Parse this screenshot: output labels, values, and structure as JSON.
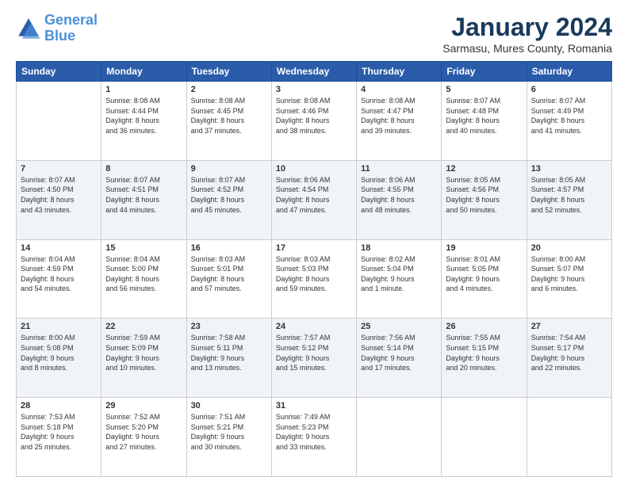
{
  "header": {
    "logo_line1": "General",
    "logo_line2": "Blue",
    "title": "January 2024",
    "subtitle": "Sarmasu, Mures County, Romania"
  },
  "days_of_week": [
    "Sunday",
    "Monday",
    "Tuesday",
    "Wednesday",
    "Thursday",
    "Friday",
    "Saturday"
  ],
  "weeks": [
    [
      {
        "day": "",
        "info": ""
      },
      {
        "day": "1",
        "info": "Sunrise: 8:08 AM\nSunset: 4:44 PM\nDaylight: 8 hours\nand 36 minutes."
      },
      {
        "day": "2",
        "info": "Sunrise: 8:08 AM\nSunset: 4:45 PM\nDaylight: 8 hours\nand 37 minutes."
      },
      {
        "day": "3",
        "info": "Sunrise: 8:08 AM\nSunset: 4:46 PM\nDaylight: 8 hours\nand 38 minutes."
      },
      {
        "day": "4",
        "info": "Sunrise: 8:08 AM\nSunset: 4:47 PM\nDaylight: 8 hours\nand 39 minutes."
      },
      {
        "day": "5",
        "info": "Sunrise: 8:07 AM\nSunset: 4:48 PM\nDaylight: 8 hours\nand 40 minutes."
      },
      {
        "day": "6",
        "info": "Sunrise: 8:07 AM\nSunset: 4:49 PM\nDaylight: 8 hours\nand 41 minutes."
      }
    ],
    [
      {
        "day": "7",
        "info": "Sunrise: 8:07 AM\nSunset: 4:50 PM\nDaylight: 8 hours\nand 43 minutes."
      },
      {
        "day": "8",
        "info": "Sunrise: 8:07 AM\nSunset: 4:51 PM\nDaylight: 8 hours\nand 44 minutes."
      },
      {
        "day": "9",
        "info": "Sunrise: 8:07 AM\nSunset: 4:52 PM\nDaylight: 8 hours\nand 45 minutes."
      },
      {
        "day": "10",
        "info": "Sunrise: 8:06 AM\nSunset: 4:54 PM\nDaylight: 8 hours\nand 47 minutes."
      },
      {
        "day": "11",
        "info": "Sunrise: 8:06 AM\nSunset: 4:55 PM\nDaylight: 8 hours\nand 48 minutes."
      },
      {
        "day": "12",
        "info": "Sunrise: 8:05 AM\nSunset: 4:56 PM\nDaylight: 8 hours\nand 50 minutes."
      },
      {
        "day": "13",
        "info": "Sunrise: 8:05 AM\nSunset: 4:57 PM\nDaylight: 8 hours\nand 52 minutes."
      }
    ],
    [
      {
        "day": "14",
        "info": "Sunrise: 8:04 AM\nSunset: 4:59 PM\nDaylight: 8 hours\nand 54 minutes."
      },
      {
        "day": "15",
        "info": "Sunrise: 8:04 AM\nSunset: 5:00 PM\nDaylight: 8 hours\nand 56 minutes."
      },
      {
        "day": "16",
        "info": "Sunrise: 8:03 AM\nSunset: 5:01 PM\nDaylight: 8 hours\nand 57 minutes."
      },
      {
        "day": "17",
        "info": "Sunrise: 8:03 AM\nSunset: 5:03 PM\nDaylight: 8 hours\nand 59 minutes."
      },
      {
        "day": "18",
        "info": "Sunrise: 8:02 AM\nSunset: 5:04 PM\nDaylight: 9 hours\nand 1 minute."
      },
      {
        "day": "19",
        "info": "Sunrise: 8:01 AM\nSunset: 5:05 PM\nDaylight: 9 hours\nand 4 minutes."
      },
      {
        "day": "20",
        "info": "Sunrise: 8:00 AM\nSunset: 5:07 PM\nDaylight: 9 hours\nand 6 minutes."
      }
    ],
    [
      {
        "day": "21",
        "info": "Sunrise: 8:00 AM\nSunset: 5:08 PM\nDaylight: 9 hours\nand 8 minutes."
      },
      {
        "day": "22",
        "info": "Sunrise: 7:59 AM\nSunset: 5:09 PM\nDaylight: 9 hours\nand 10 minutes."
      },
      {
        "day": "23",
        "info": "Sunrise: 7:58 AM\nSunset: 5:11 PM\nDaylight: 9 hours\nand 13 minutes."
      },
      {
        "day": "24",
        "info": "Sunrise: 7:57 AM\nSunset: 5:12 PM\nDaylight: 9 hours\nand 15 minutes."
      },
      {
        "day": "25",
        "info": "Sunrise: 7:56 AM\nSunset: 5:14 PM\nDaylight: 9 hours\nand 17 minutes."
      },
      {
        "day": "26",
        "info": "Sunrise: 7:55 AM\nSunset: 5:15 PM\nDaylight: 9 hours\nand 20 minutes."
      },
      {
        "day": "27",
        "info": "Sunrise: 7:54 AM\nSunset: 5:17 PM\nDaylight: 9 hours\nand 22 minutes."
      }
    ],
    [
      {
        "day": "28",
        "info": "Sunrise: 7:53 AM\nSunset: 5:18 PM\nDaylight: 9 hours\nand 25 minutes."
      },
      {
        "day": "29",
        "info": "Sunrise: 7:52 AM\nSunset: 5:20 PM\nDaylight: 9 hours\nand 27 minutes."
      },
      {
        "day": "30",
        "info": "Sunrise: 7:51 AM\nSunset: 5:21 PM\nDaylight: 9 hours\nand 30 minutes."
      },
      {
        "day": "31",
        "info": "Sunrise: 7:49 AM\nSunset: 5:23 PM\nDaylight: 9 hours\nand 33 minutes."
      },
      {
        "day": "",
        "info": ""
      },
      {
        "day": "",
        "info": ""
      },
      {
        "day": "",
        "info": ""
      }
    ]
  ]
}
